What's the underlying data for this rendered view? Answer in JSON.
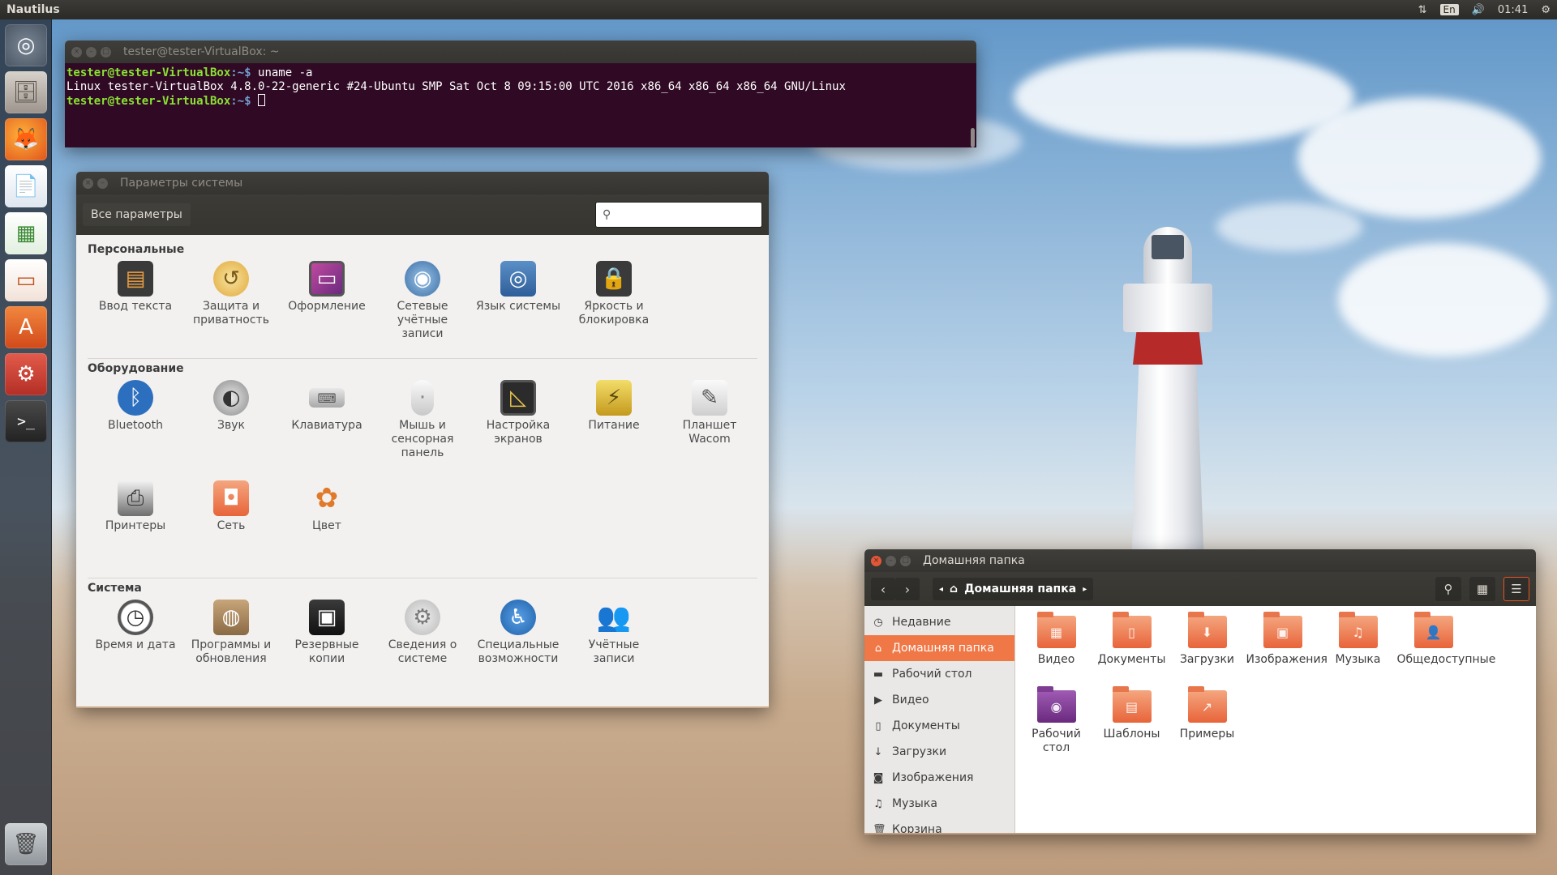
{
  "top_panel": {
    "app_name": "Nautilus",
    "lang": "En",
    "time": "01:41"
  },
  "launcher": {
    "items": [
      "ubuntu-dash",
      "files",
      "firefox",
      "libreoffice-writer",
      "libreoffice-calc",
      "libreoffice-impress",
      "ubuntu-software",
      "system-settings",
      "terminal",
      "trash"
    ]
  },
  "terminal": {
    "title": "tester@tester-VirtualBox: ~",
    "prompt_user": "tester@tester-VirtualBox",
    "prompt_path": ":~$",
    "command": " uname -a",
    "output": "Linux tester-VirtualBox 4.8.0-22-generic #24-Ubuntu SMP Sat Oct 8 09:15:00 UTC 2016 x86_64 x86_64 x86_64 GNU/Linux"
  },
  "settings": {
    "title": "Параметры системы",
    "all_settings": "Все параметры",
    "search_placeholder": "",
    "sections": {
      "personal": {
        "title": "Персональные",
        "items": [
          "Ввод текста",
          "Защита и приватность",
          "Оформление",
          "Сетевые учётные записи",
          "Язык системы",
          "Яркость и блокировка"
        ]
      },
      "hardware": {
        "title": "Оборудование",
        "items": [
          "Bluetooth",
          "Звук",
          "Клавиатура",
          "Мышь и сенсорная панель",
          "Настройка экранов",
          "Питание",
          "Планшет Wacom",
          "Принтеры",
          "Сеть",
          "Цвет"
        ]
      },
      "system": {
        "title": "Система",
        "items": [
          "Время и дата",
          "Программы и обновления",
          "Резервные копии",
          "Сведения о системе",
          "Специальные возможности",
          "Учётные записи"
        ]
      }
    }
  },
  "files": {
    "title": "Домашняя папка",
    "path": "Домашняя папка",
    "sidebar": [
      "Недавние",
      "Домашняя папка",
      "Рабочий стол",
      "Видео",
      "Документы",
      "Загрузки",
      "Изображения",
      "Музыка",
      "Корзина"
    ],
    "sidebar_active_index": 1,
    "folders": [
      "Видео",
      "Документы",
      "Загрузки",
      "Изображения",
      "Музыка",
      "Общедоступные",
      "Рабочий стол",
      "Шаблоны",
      "Примеры"
    ]
  },
  "colors": {
    "accent": "#e95420",
    "terminal_bg": "#300a24",
    "sidebar_active": "#f07746"
  }
}
